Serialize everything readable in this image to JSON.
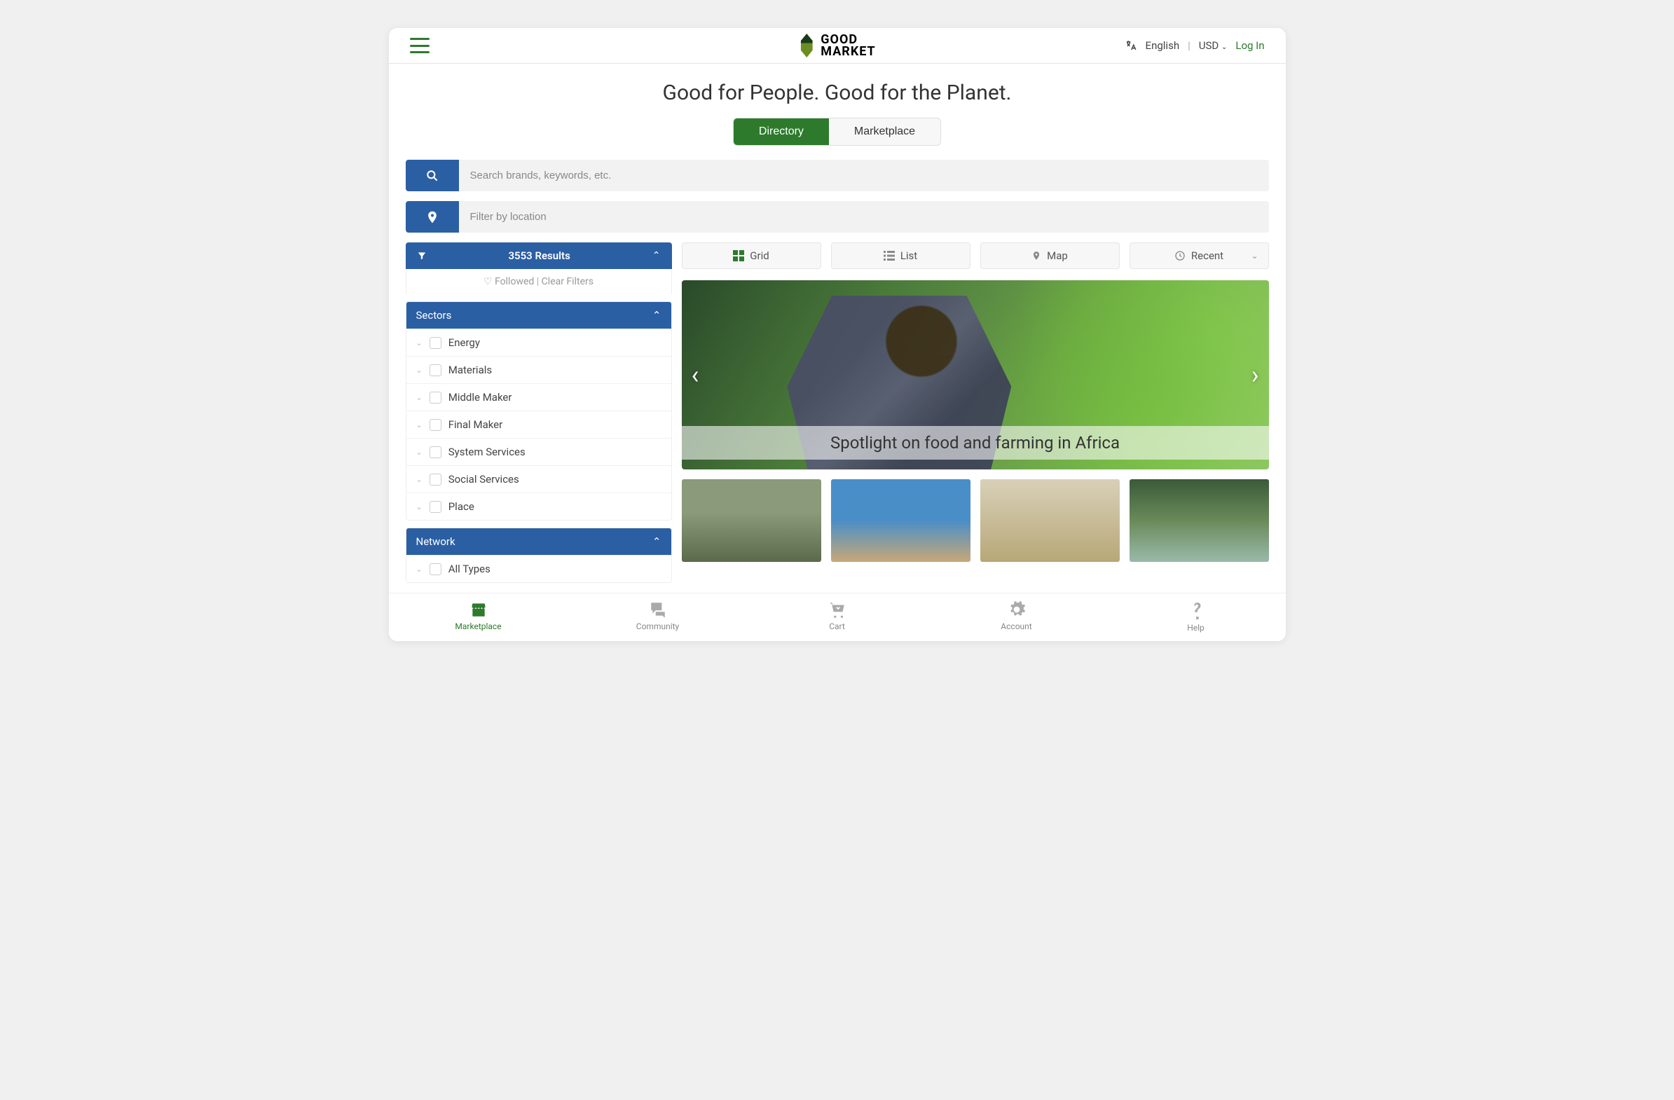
{
  "header": {
    "brand_line1": "GOOD",
    "brand_line2": "MARKET",
    "language": "English",
    "currency": "USD",
    "login": "Log In"
  },
  "tagline": "Good for People. Good for the Planet.",
  "mode": {
    "directory": "Directory",
    "marketplace": "Marketplace"
  },
  "search": {
    "keyword_placeholder": "Search brands, keywords, etc.",
    "location_placeholder": "Filter by location"
  },
  "results": {
    "count_label": "3553 Results",
    "followed": "Followed",
    "clear": "Clear Filters"
  },
  "panels": {
    "sectors": {
      "title": "Sectors",
      "items": [
        "Energy",
        "Materials",
        "Middle Maker",
        "Final Maker",
        "System Services",
        "Social Services",
        "Place"
      ]
    },
    "network": {
      "title": "Network",
      "items": [
        "All Types"
      ]
    }
  },
  "views": {
    "grid": "Grid",
    "list": "List",
    "map": "Map",
    "sort": "Recent"
  },
  "hero": {
    "caption": "Spotlight on food and farming in Africa"
  },
  "bottom_nav": {
    "marketplace": "Marketplace",
    "community": "Community",
    "cart": "Cart",
    "account": "Account",
    "help": "Help"
  }
}
